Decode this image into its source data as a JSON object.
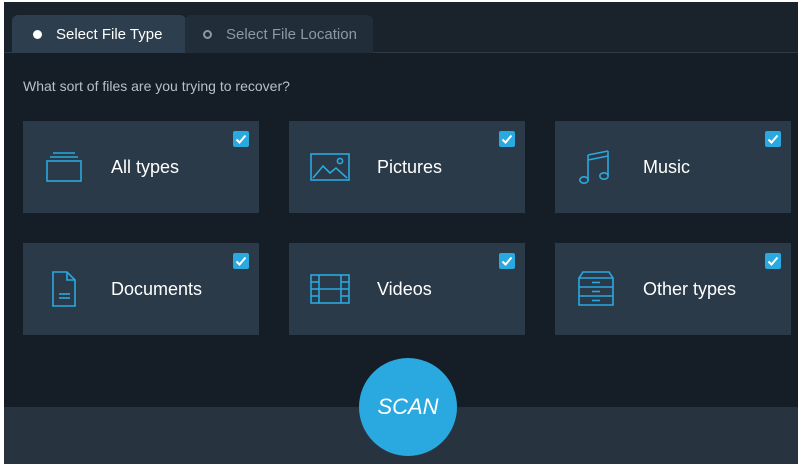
{
  "tabs": [
    {
      "label": "Select File Type",
      "state": "active"
    },
    {
      "label": "Select File Location",
      "state": "inactive"
    }
  ],
  "prompt": "What sort of files are you trying to recover?",
  "file_types": [
    {
      "label": "All types",
      "icon": "all-types-icon",
      "checked": true
    },
    {
      "label": "Pictures",
      "icon": "picture-icon",
      "checked": true
    },
    {
      "label": "Music",
      "icon": "music-note-icon",
      "checked": true
    },
    {
      "label": "Documents",
      "icon": "document-icon",
      "checked": true
    },
    {
      "label": "Videos",
      "icon": "film-icon",
      "checked": true
    },
    {
      "label": "Other types",
      "icon": "cabinet-icon",
      "checked": true
    }
  ],
  "scan_label": "SCAN",
  "colors": {
    "background": "#151d26",
    "tile": "#2b3a48",
    "accent": "#2aa8e0",
    "icon_stroke": "#2aa8e0"
  }
}
